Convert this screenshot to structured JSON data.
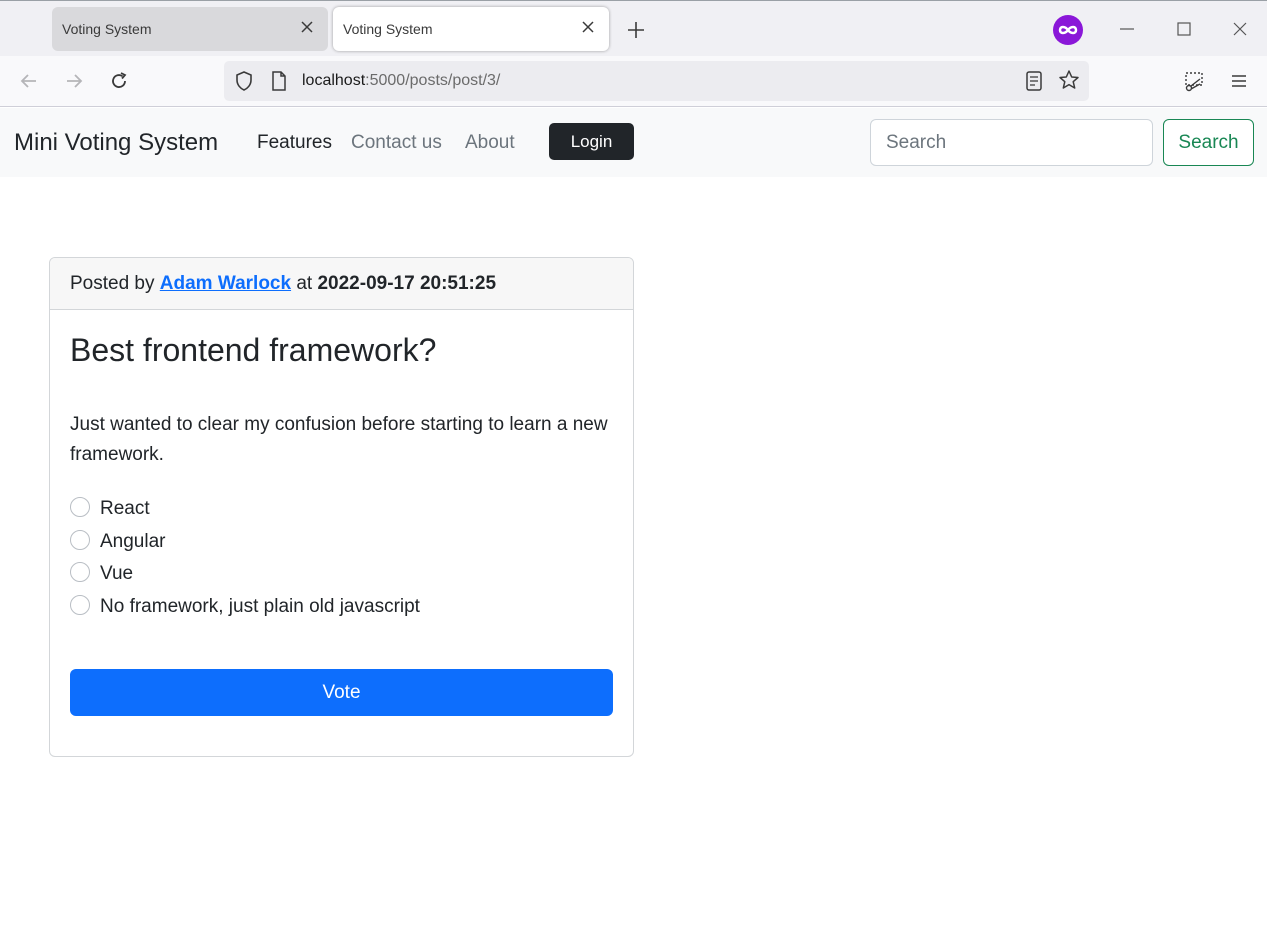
{
  "browser": {
    "tabs": [
      {
        "title": "Voting System",
        "active": false
      },
      {
        "title": "Voting System",
        "active": true
      }
    ],
    "url_host": "localhost",
    "url_rest": ":5000/posts/post/3/",
    "extension_color": "#8a17d8"
  },
  "site": {
    "brand": "Mini Voting System",
    "nav": {
      "features": "Features",
      "contact": "Contact us",
      "about": "About"
    },
    "login_label": "Login",
    "search_placeholder": "Search",
    "search_button": "Search"
  },
  "post": {
    "posted_by_prefix": "Posted by",
    "author": "Adam Warlock",
    "at_word": "at",
    "timestamp": "2022-09-17 20:51:25",
    "title": "Best frontend framework?",
    "description": "Just wanted to clear my confusion before starting to learn a new framework.",
    "options": [
      {
        "label": "React"
      },
      {
        "label": "Angular"
      },
      {
        "label": "Vue"
      },
      {
        "label": "No framework, just plain old javascript"
      }
    ],
    "vote_label": "Vote"
  },
  "colors": {
    "primary": "#0d6efd",
    "success": "#198754",
    "dark": "#212529"
  }
}
